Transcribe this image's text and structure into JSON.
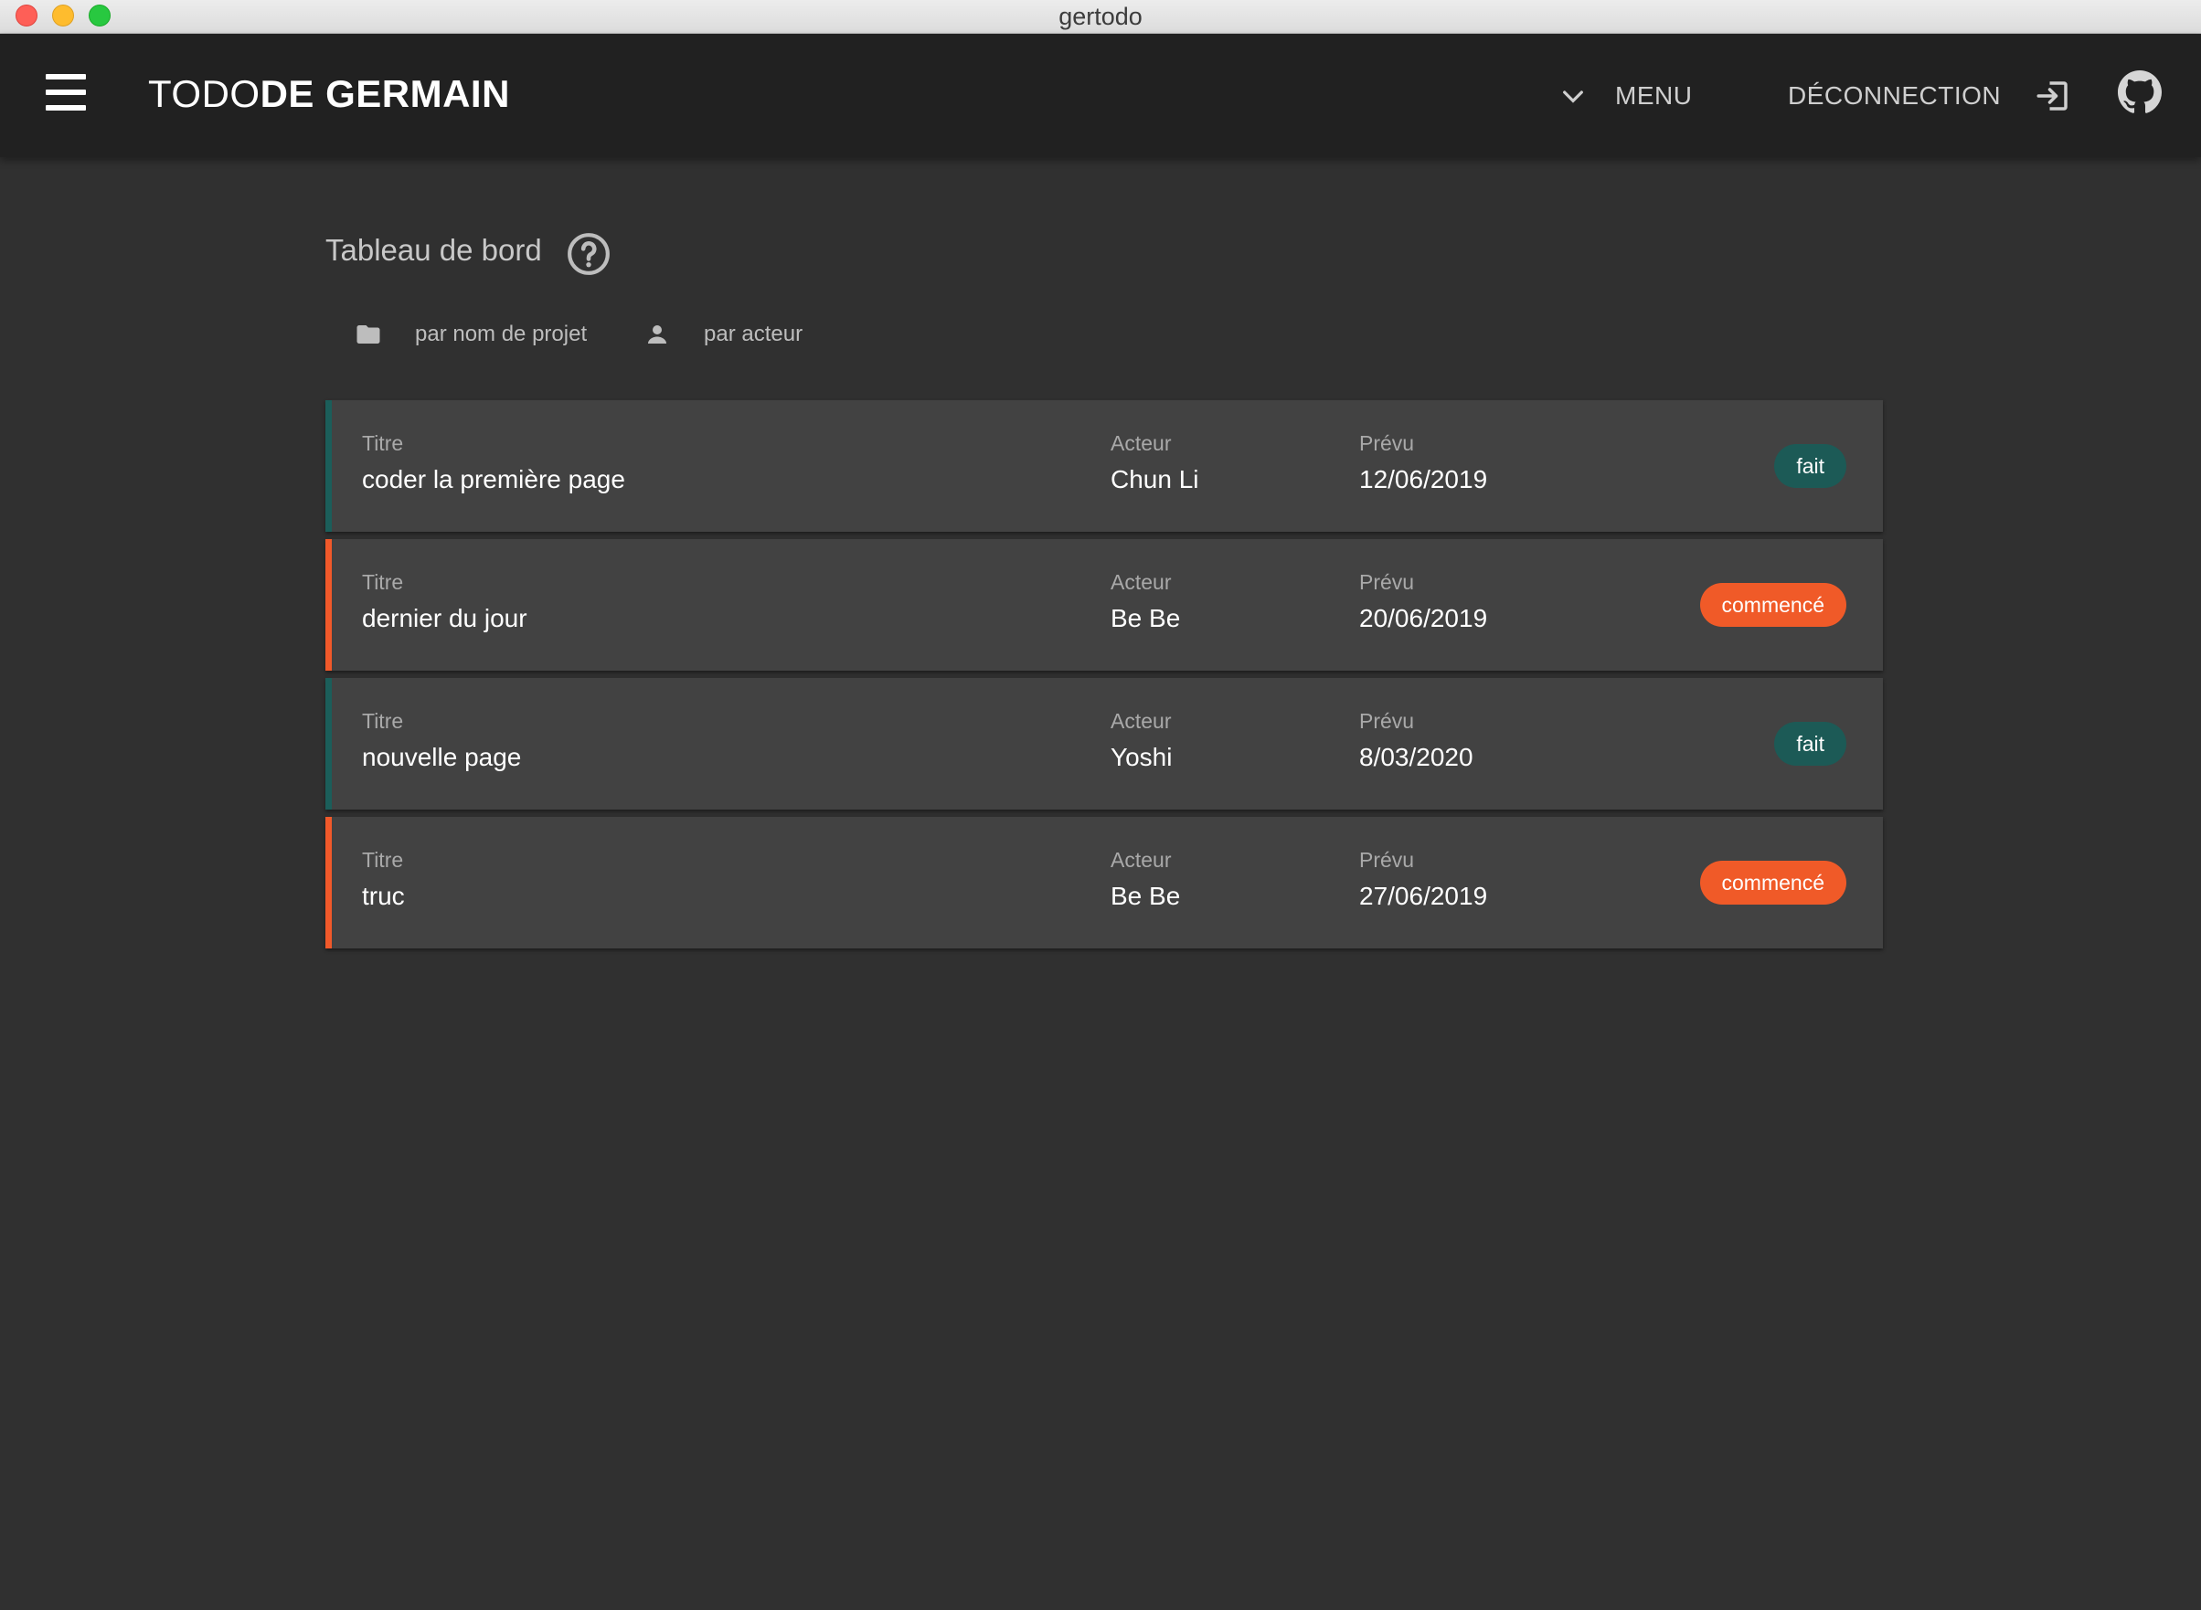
{
  "window": {
    "title": "gertodo"
  },
  "appbar": {
    "brand_light": "TODO",
    "brand_bold": "DE GERMAIN",
    "menu_label": "MENU",
    "logout_label": "DÉCONNECTION"
  },
  "dashboard": {
    "title": "Tableau de bord",
    "filters": {
      "project": "par nom de projet",
      "actor": "par acteur"
    }
  },
  "labels": {
    "title": "Titre",
    "actor": "Acteur",
    "planned": "Prévu"
  },
  "tasks": [
    {
      "title": "coder la première page",
      "actor": "Chun Li",
      "planned": "12/06/2019",
      "status": "fait"
    },
    {
      "title": "dernier du jour",
      "actor": "Be Be",
      "planned": "20/06/2019",
      "status": "commencé"
    },
    {
      "title": "nouvelle page",
      "actor": "Yoshi",
      "planned": "8/03/2020",
      "status": "fait"
    },
    {
      "title": "truc",
      "actor": "Be Be",
      "planned": "27/06/2019",
      "status": "commencé"
    }
  ],
  "colors": {
    "done": "#1c5a56",
    "started": "#f05a28",
    "background": "#303030",
    "appbar": "#212121",
    "card": "#424242"
  },
  "icons": {
    "menu": "hamburger-icon",
    "dropdown": "chevron-down-icon",
    "logout": "logout-icon",
    "github": "github-icon",
    "help": "help-circle-icon",
    "project_filter": "folder-icon",
    "actor_filter": "person-icon"
  }
}
